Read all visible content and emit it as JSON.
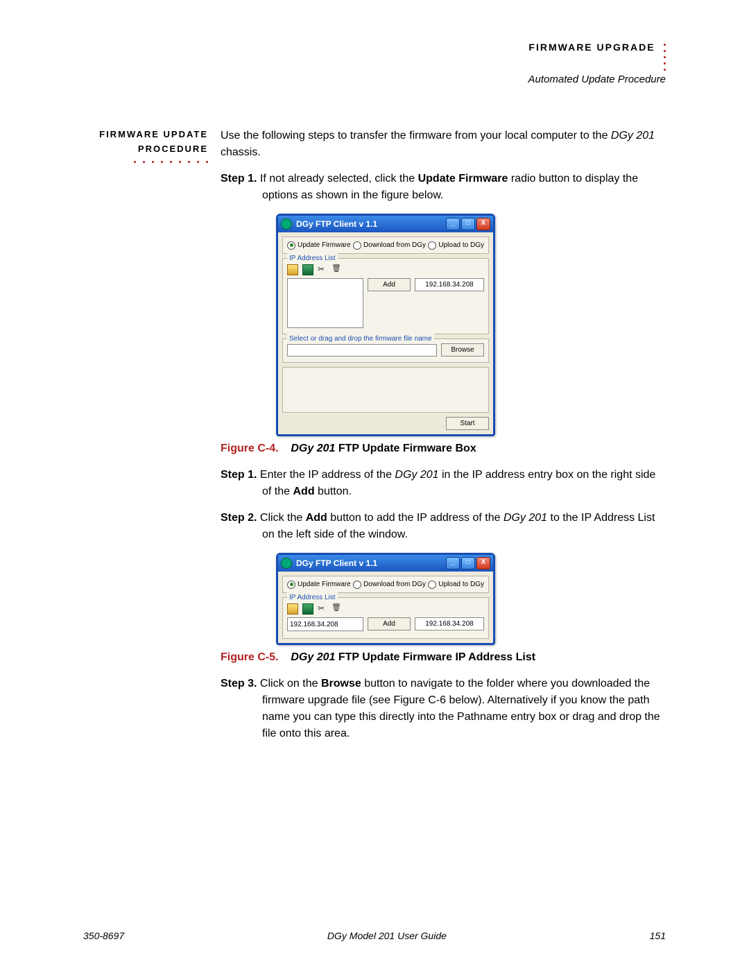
{
  "header": {
    "title": "FIRMWARE UPGRADE",
    "subtitle": "Automated Update Procedure"
  },
  "sidehead": {
    "line1": "FIRMWARE UPDATE",
    "line2": "PROCEDURE"
  },
  "intro": {
    "pre": "Use the following steps to transfer the firmware from your local computer to the ",
    "em": "DGy 201",
    "post": " chassis."
  },
  "steps_a": {
    "s1_label": "Step 1.",
    "s1_a": " If not already selected, click the ",
    "s1_b": "Update Firmware",
    "s1_c": " radio button to display the options as shown in the figure below."
  },
  "fig_c4": {
    "num": "Figure C-4.",
    "em": "DGy 201",
    "rest": " FTP Update Firmware Box"
  },
  "steps_b": {
    "s1_label": "Step 1.",
    "s1_a": " Enter the IP address of the ",
    "s1_em": "DGy 201",
    "s1_b": " in the IP address entry box on the right side of the ",
    "s1_bold": "Add",
    "s1_c": " button.",
    "s2_label": "Step 2.",
    "s2_a": " Click the ",
    "s2_bold": "Add",
    "s2_b": " button to add the IP address of the ",
    "s2_em": "DGy 201",
    "s2_c": " to the IP Address List on the left side of the window."
  },
  "fig_c5": {
    "num": "Figure C-5.",
    "em": "DGy 201",
    "rest": " FTP Update Firmware IP Address List"
  },
  "steps_c": {
    "s3_label": "Step 3.",
    "s3_a": " Click on the ",
    "s3_bold": "Browse",
    "s3_b": " button to navigate to the folder where you downloaded the firmware upgrade file (see Figure C-6 below). Alternatively if you know the path name you can type this directly into the Pathname entry box or drag and drop the file onto this area."
  },
  "dialog": {
    "title": "DGy FTP Client v 1.1",
    "radios": {
      "r1": "Update Firmware",
      "r2": "Download from DGy",
      "r3": "Upload to DGy"
    },
    "ip_legend": "IP Address List",
    "add": "Add",
    "ip_value": "192.168.34.208",
    "file_legend": "Select or drag and drop the firmware file name",
    "browse": "Browse",
    "start": "Start",
    "list_entry": "192.168.34.208"
  },
  "footer": {
    "left": "350-8697",
    "center": "DGy Model 201 User Guide",
    "right": "151"
  }
}
